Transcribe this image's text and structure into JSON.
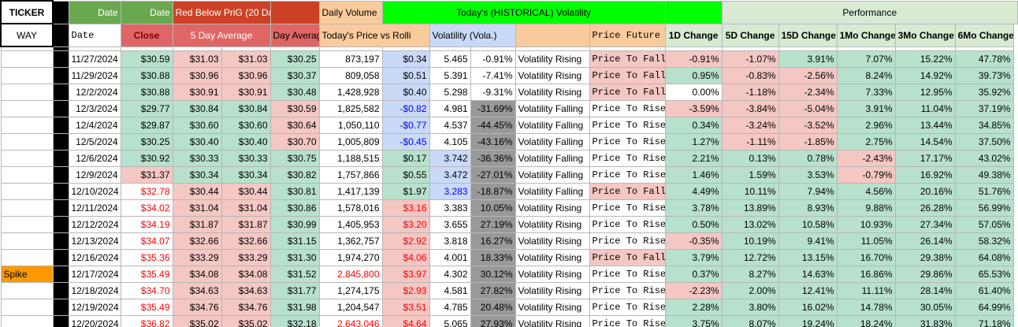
{
  "ticker": {
    "label": "TICKER",
    "value": "WAY"
  },
  "header": {
    "date_a": "Date",
    "date_b": "Date",
    "red_below": "Red Below PriG (20 Day)",
    "daily_volume": "Daily Volume",
    "hist_vol": "Today's (HISTORICAL) Volatility",
    "performance": "Performance"
  },
  "subheader": {
    "date": "Date",
    "close": "Close",
    "five_day": "5 Day Average",
    "day_avg": "Day Average",
    "price_vs_roll": "Today's Price vs Rolli",
    "volatility": "Volatility (Vola.)",
    "future_path": "Price Future Path",
    "d1": "1D Change",
    "d5": "5D Change",
    "d15": "15D Change",
    "m1": "1Mo Change",
    "m3": "3Mo Change",
    "m6": "6Mo Change"
  },
  "rows": [
    {
      "tag": "",
      "date": "11/27/2024",
      "close": "$30.59",
      "avg5a": "$31.03",
      "avg5b": "$31.03",
      "avg20": "$30.25",
      "vol": "873,197",
      "pvr": "$0.34",
      "vola": "5.465",
      "volpct": "-0.91%",
      "status": "Volatility Rising",
      "path": "Price To Fall",
      "d1": "-0.91%",
      "d5": "-1.07%",
      "d15": "3.91%",
      "m1": "7.07%",
      "m3": "15.22%",
      "m6": "47.78%"
    },
    {
      "tag": "",
      "date": "11/29/2024",
      "close": "$30.88",
      "avg5a": "$30.96",
      "avg5b": "$30.96",
      "avg20": "$30.37",
      "vol": "809,058",
      "pvr": "$0.51",
      "vola": "5.391",
      "volpct": "-7.41%",
      "status": "Volatility Rising",
      "path": "Price To Fall",
      "d1": "0.95%",
      "d5": "-0.83%",
      "d15": "-2.56%",
      "m1": "8.24%",
      "m3": "14.92%",
      "m6": "39.73%"
    },
    {
      "tag": "",
      "date": "12/2/2024",
      "close": "$30.88",
      "avg5a": "$30.91",
      "avg5b": "$30.91",
      "avg20": "$30.48",
      "vol": "1,428,928",
      "pvr": "$0.40",
      "vola": "5.298",
      "volpct": "-9.31%",
      "status": "Volatility Rising",
      "path": "Price To Fall",
      "d1": "0.00%",
      "d5": "-1.18%",
      "d15": "-2.34%",
      "m1": "7.33%",
      "m3": "12.95%",
      "m6": "35.92%"
    },
    {
      "tag": "",
      "date": "12/3/2024",
      "close": "$29.77",
      "avg5a": "$30.84",
      "avg5b": "$30.84",
      "avg20": "$30.59",
      "vol": "1,825,582",
      "pvr": "-$0.82",
      "vola": "4.981",
      "volpct": "-31.69%",
      "status": "Volatility Falling",
      "path": "Price To Rise",
      "d1": "-3.59%",
      "d5": "-3.84%",
      "d15": "-5.04%",
      "m1": "3.91%",
      "m3": "11.04%",
      "m6": "37.19%"
    },
    {
      "tag": "",
      "date": "12/4/2024",
      "close": "$29.87",
      "avg5a": "$30.60",
      "avg5b": "$30.60",
      "avg20": "$30.64",
      "vol": "1,050,110",
      "pvr": "-$0.77",
      "vola": "4.537",
      "volpct": "-44.45%",
      "status": "Volatility Falling",
      "path": "Price To Rise",
      "d1": "0.34%",
      "d5": "-3.24%",
      "d15": "-3.52%",
      "m1": "2.96%",
      "m3": "13.44%",
      "m6": "34.85%"
    },
    {
      "tag": "",
      "date": "12/5/2024",
      "close": "$30.25",
      "avg5a": "$30.40",
      "avg5b": "$30.40",
      "avg20": "$30.70",
      "vol": "1,005,809",
      "pvr": "-$0.45",
      "vola": "4.105",
      "volpct": "-43.16%",
      "status": "Volatility Falling",
      "path": "Price To Rise",
      "d1": "1.27%",
      "d5": "-1.11%",
      "d15": "-1.85%",
      "m1": "2.75%",
      "m3": "14.54%",
      "m6": "37.50%"
    },
    {
      "tag": "",
      "date": "12/6/2024",
      "close": "$30.92",
      "avg5a": "$30.33",
      "avg5b": "$30.33",
      "avg20": "$30.75",
      "vol": "1,188,515",
      "pvr": "$0.17",
      "vola": "3.742",
      "volpct": "-36.36%",
      "status": "Volatility Falling",
      "path": "Price To Rise",
      "d1": "2.21%",
      "d5": "0.13%",
      "d15": "0.78%",
      "m1": "-2.43%",
      "m3": "17.17%",
      "m6": "43.02%"
    },
    {
      "tag": "",
      "date": "12/9/2024",
      "close": "$31.37",
      "avg5a": "$30.34",
      "avg5b": "$30.34",
      "avg20": "$30.82",
      "vol": "1,757,866",
      "pvr": "$0.55",
      "vola": "3.472",
      "volpct": "-27.01%",
      "status": "Volatility Falling",
      "path": "Price To Rise",
      "d1": "1.46%",
      "d5": "1.59%",
      "d15": "3.53%",
      "m1": "-0.79%",
      "m3": "16.92%",
      "m6": "49.38%"
    },
    {
      "tag": "",
      "date": "12/10/2024",
      "close": "$32.78",
      "avg5a": "$30.44",
      "avg5b": "$30.44",
      "avg20": "$30.81",
      "vol": "1,417,139",
      "pvr": "$1.97",
      "vola": "3.283",
      "volpct": "-18.87%",
      "status": "Volatility Falling",
      "path": "Price To Fall",
      "d1": "4.49%",
      "d5": "10.11%",
      "d15": "7.94%",
      "m1": "4.56%",
      "m3": "20.16%",
      "m6": "51.76%"
    },
    {
      "tag": "",
      "date": "12/11/2024",
      "close": "$34.02",
      "avg5a": "$31.04",
      "avg5b": "$31.04",
      "avg20": "$30.86",
      "vol": "1,578,016",
      "pvr": "$3.16",
      "vola": "3.383",
      "volpct": "10.05%",
      "status": "Volatility Rising",
      "path": "Price To Rise",
      "d1": "3.78%",
      "d5": "13.89%",
      "d15": "8.93%",
      "m1": "9.88%",
      "m3": "26.28%",
      "m6": "56.99%"
    },
    {
      "tag": "",
      "date": "12/12/2024",
      "close": "$34.19",
      "avg5a": "$31.87",
      "avg5b": "$31.87",
      "avg20": "$30.99",
      "vol": "1,405,953",
      "pvr": "$3.20",
      "vola": "3.655",
      "volpct": "27.19%",
      "status": "Volatility Rising",
      "path": "Price To Rise",
      "d1": "0.50%",
      "d5": "13.02%",
      "d15": "10.58%",
      "m1": "10.93%",
      "m3": "27.34%",
      "m6": "57.05%"
    },
    {
      "tag": "",
      "date": "12/13/2024",
      "close": "$34.07",
      "avg5a": "$32.66",
      "avg5b": "$32.66",
      "avg20": "$31.15",
      "vol": "1,362,757",
      "pvr": "$2.92",
      "vola": "3.818",
      "volpct": "16.27%",
      "status": "Volatility Rising",
      "path": "Price To Rise",
      "d1": "-0.35%",
      "d5": "10.19%",
      "d15": "9.41%",
      "m1": "11.05%",
      "m3": "26.14%",
      "m6": "58.32%"
    },
    {
      "tag": "",
      "date": "12/16/2024",
      "close": "$35.36",
      "avg5a": "$33.29",
      "avg5b": "$33.29",
      "avg20": "$31.30",
      "vol": "1,974,270",
      "pvr": "$4.06",
      "vola": "4.001",
      "volpct": "18.33%",
      "status": "Volatility Rising",
      "path": "Price To Fall",
      "d1": "3.79%",
      "d5": "12.72%",
      "d15": "13.15%",
      "m1": "16.70%",
      "m3": "29.38%",
      "m6": "64.08%"
    },
    {
      "tag": "Spike",
      "date": "12/17/2024",
      "close": "$35.49",
      "avg5a": "$34.08",
      "avg5b": "$34.08",
      "avg20": "$31.52",
      "vol": "2,845,800",
      "pvr": "$3.97",
      "vola": "4.302",
      "volpct": "30.12%",
      "status": "Volatility Rising",
      "path": "Price To Rise",
      "d1": "0.37%",
      "d5": "8.27%",
      "d15": "14.63%",
      "m1": "16.86%",
      "m3": "29.86%",
      "m6": "65.53%"
    },
    {
      "tag": "",
      "date": "12/18/2024",
      "close": "$34.70",
      "avg5a": "$34.63",
      "avg5b": "$34.63",
      "avg20": "$31.77",
      "vol": "1,274,175",
      "pvr": "$2.93",
      "vola": "4.581",
      "volpct": "27.82%",
      "status": "Volatility Rising",
      "path": "Price To Rise",
      "d1": "-2.23%",
      "d5": "2.00%",
      "d15": "12.41%",
      "m1": "11.11%",
      "m3": "28.14%",
      "m6": "61.40%"
    },
    {
      "tag": "",
      "date": "12/19/2024",
      "close": "$35.49",
      "avg5a": "$34.76",
      "avg5b": "$34.76",
      "avg20": "$31.98",
      "vol": "1,204,547",
      "pvr": "$3.51",
      "vola": "4.785",
      "volpct": "20.48%",
      "status": "Volatility Rising",
      "path": "Price To Rise",
      "d1": "2.28%",
      "d5": "3.80%",
      "d15": "16.02%",
      "m1": "14.78%",
      "m3": "30.05%",
      "m6": "64.99%"
    },
    {
      "tag": "",
      "date": "12/20/2024",
      "close": "$36.82",
      "avg5a": "$35.02",
      "avg5b": "$35.02",
      "avg20": "$32.18",
      "vol": "2,643,046",
      "pvr": "$4.64",
      "vola": "5.065",
      "volpct": "27.93%",
      "status": "Volatility Rising",
      "path": "Price To Rise",
      "d1": "3.75%",
      "d5": "8.07%",
      "d15": "19.24%",
      "m1": "18.24%",
      "m3": "31.83%",
      "m6": "71.18%"
    }
  ],
  "styles": {
    "close_red_rows": [
      8,
      9,
      10,
      11,
      12,
      13,
      14,
      15,
      16
    ],
    "close_lightred_rows": [
      7
    ],
    "avg5_lightred_rows": [
      0,
      1,
      2,
      8,
      9,
      10,
      11,
      12,
      13,
      14,
      15,
      16
    ],
    "avg20_lightred_rows": [
      3,
      4,
      5
    ],
    "vol_red_rows": [
      13,
      16
    ],
    "pvr_blue_rows": [
      3,
      4,
      5
    ],
    "pvr_red_rows": [
      9,
      10,
      11,
      12,
      13,
      14,
      15,
      16
    ],
    "pvr_lightblue_rows": [
      0,
      1,
      2,
      3,
      4,
      5
    ],
    "pvr_lightred_rows": [
      9,
      10,
      11,
      12,
      13,
      14,
      15,
      16
    ],
    "vola_blue_rows": [
      8
    ],
    "vola_lightblue_rows": [
      6,
      7
    ],
    "volpct_gray_rows": [
      3,
      4,
      5,
      6,
      7,
      8,
      9,
      10,
      11,
      12,
      13,
      14,
      15,
      16
    ],
    "path_lightred_rows": [
      0,
      1,
      2,
      8,
      12
    ],
    "d1_lightred_rows": [
      0,
      3,
      11,
      14
    ],
    "d1_white_rows": [
      2
    ],
    "d5_lightred_rows": [
      0,
      1,
      2,
      3,
      4,
      5
    ],
    "d15_lightred_rows": [
      1,
      2,
      3,
      4,
      5
    ],
    "m1_lightred_rows": [
      6,
      7
    ]
  }
}
